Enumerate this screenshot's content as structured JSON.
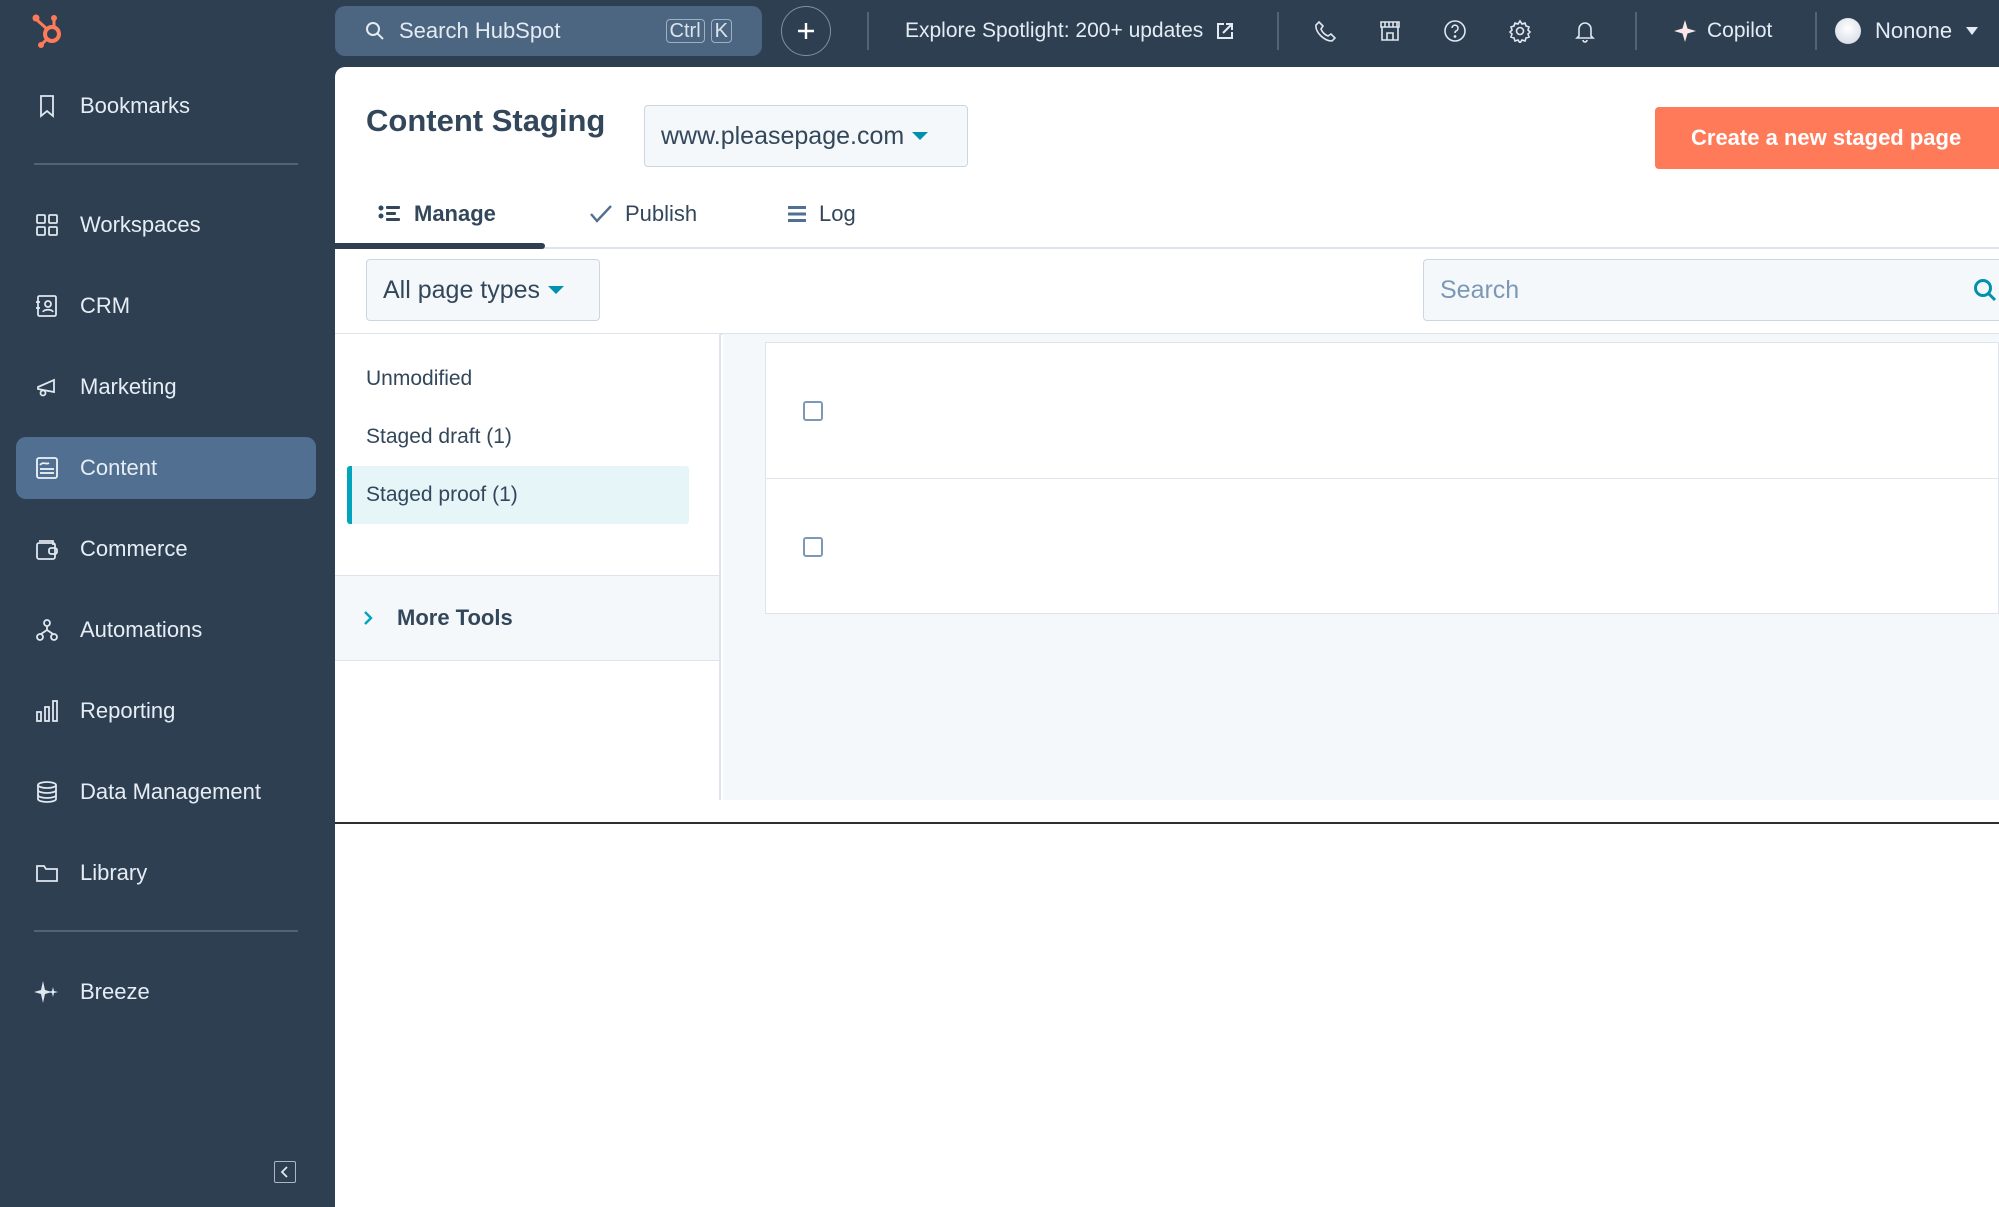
{
  "brand": {
    "accent": "#ff7a59",
    "sidebar_bg": "#2e3f52",
    "teal": "#00a4bd"
  },
  "sidebar": {
    "items": [
      {
        "label": "Bookmarks",
        "icon": "bookmark-icon"
      },
      {
        "label": "Workspaces",
        "icon": "grid-icon"
      },
      {
        "label": "CRM",
        "icon": "contacts-icon"
      },
      {
        "label": "Marketing",
        "icon": "megaphone-icon"
      },
      {
        "label": "Content",
        "icon": "content-icon",
        "active": true
      },
      {
        "label": "Commerce",
        "icon": "wallet-icon"
      },
      {
        "label": "Automations",
        "icon": "workflow-icon"
      },
      {
        "label": "Reporting",
        "icon": "bar-chart-icon"
      },
      {
        "label": "Data Management",
        "icon": "database-icon"
      },
      {
        "label": "Library",
        "icon": "folder-icon"
      },
      {
        "label": "Breeze",
        "icon": "sparkle-icon"
      }
    ]
  },
  "topbar": {
    "search_placeholder": "Search HubSpot",
    "shortcut_keys": [
      "Ctrl",
      "K"
    ],
    "spotlight_label": "Explore Spotlight: 200+ updates",
    "copilot_label": "Copilot",
    "user_name": "Nonone"
  },
  "page": {
    "title": "Content Staging",
    "domain_selected": "www.pleasepage.com",
    "create_button": "Create a new staged page",
    "tabs": [
      {
        "label": "Manage",
        "active": true
      },
      {
        "label": "Publish"
      },
      {
        "label": "Log"
      }
    ],
    "type_filter_selected": "All page types",
    "search_placeholder": "Search"
  },
  "filters": {
    "items": [
      {
        "label": "Unmodified"
      },
      {
        "label": "Staged draft (1)"
      },
      {
        "label": "Staged proof (1)",
        "active": true
      }
    ],
    "more_tools_label": "More Tools"
  },
  "table": {
    "rows": [
      {
        "checked": false
      },
      {
        "checked": false
      }
    ]
  }
}
